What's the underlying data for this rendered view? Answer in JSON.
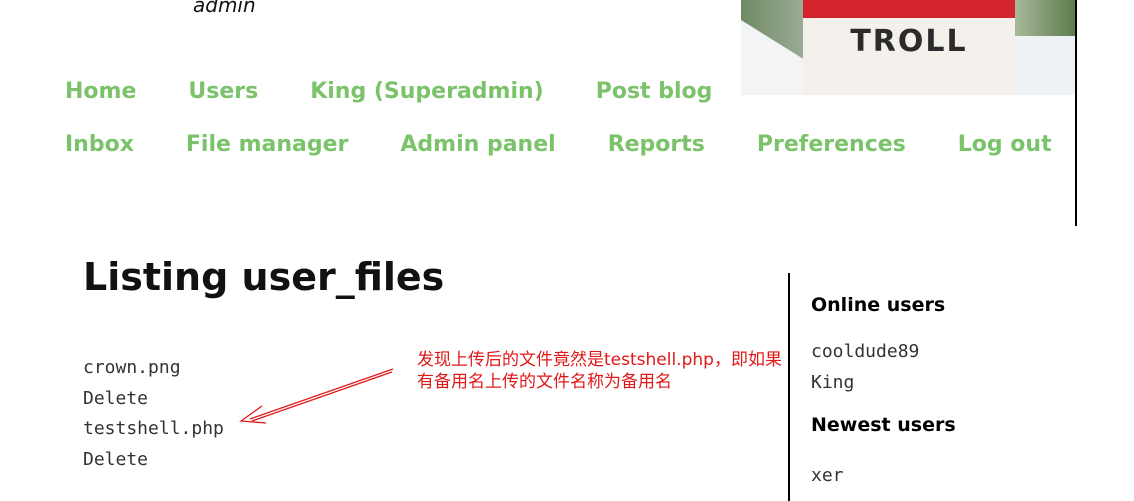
{
  "header": {
    "username": "admin",
    "banner_sign_text": "TROLL"
  },
  "nav": {
    "row1": [
      "Home",
      "Users",
      "King (Superadmin)",
      "Post blog"
    ],
    "row2": [
      "Inbox",
      "File manager",
      "Admin panel",
      "Reports",
      "Preferences",
      "Log out"
    ]
  },
  "main": {
    "title": "Listing user_files",
    "files": [
      {
        "name": "crown.png",
        "delete_label": "Delete"
      },
      {
        "name": "testshell.php",
        "delete_label": "Delete"
      }
    ]
  },
  "annotation": {
    "line1": "发现上传后的文件竟然是testshell.php，即如果",
    "line2": "有备用名上传的文件名称为备用名",
    "color": "#e01818"
  },
  "sidebar": {
    "online_heading": "Online users",
    "online_users": [
      "cooldude89",
      "King"
    ],
    "newest_heading": "Newest users",
    "newest_users": [
      "xer"
    ]
  },
  "colors": {
    "nav_link": "#7bc36a",
    "banner_red": "#d3232d"
  }
}
